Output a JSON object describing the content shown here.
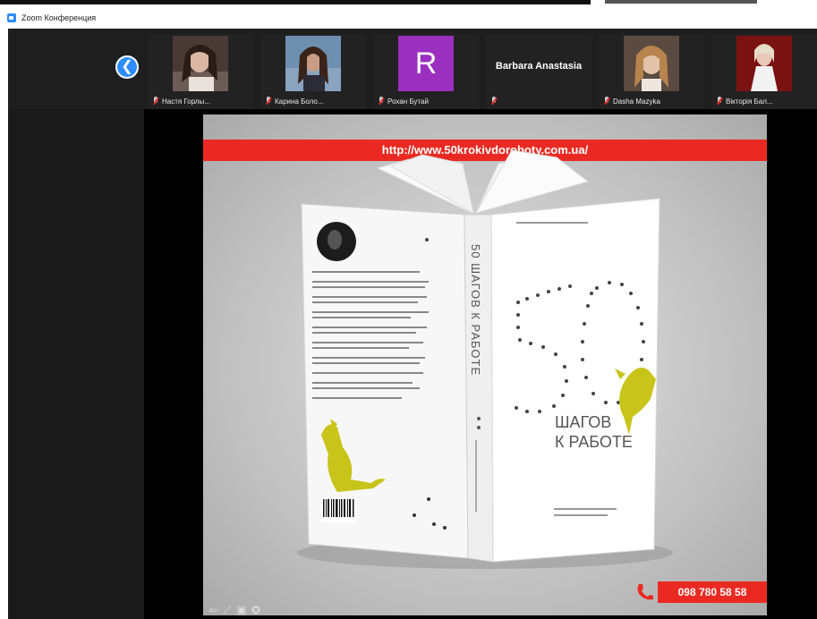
{
  "window": {
    "title": "Zoom Конференция"
  },
  "participants": [
    {
      "name": "Настя Горлы..."
    },
    {
      "name": "Карина Боло..."
    },
    {
      "name": "Рохан Бутай"
    },
    {
      "name": "Barbara Anastasia"
    },
    {
      "name": "Dasha Mazyka"
    },
    {
      "name": "Вікторія Бал..."
    }
  ],
  "avatar_letter": "R",
  "slide": {
    "url": "http://www.50krokivdoroboty.com.ua/",
    "phone": "098 780 58 58",
    "book": {
      "spine": "50 ШАГОВ К РАБОТЕ",
      "cover_number": "50",
      "cover_title_line1": "ШАГОВ",
      "cover_title_line2": "К РАБОТЕ"
    }
  },
  "colors": {
    "accent_red": "#ea2a22",
    "zoom_blue": "#2d8cff",
    "avatar_purple": "#9b2fbf",
    "cat_yellow": "#c8c41a"
  }
}
